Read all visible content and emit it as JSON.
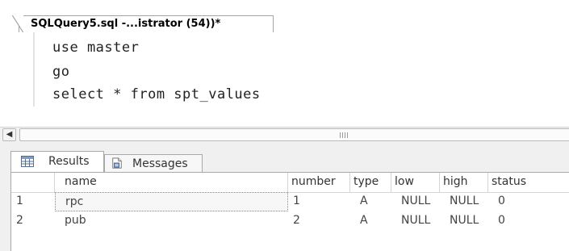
{
  "query_tab": {
    "title": "SQLQuery5.sql -...istrator (54))*"
  },
  "editor": {
    "lines": [
      "use master",
      "go",
      "select * from spt_values"
    ]
  },
  "results": {
    "tabs": {
      "results_label": "Results",
      "messages_label": "Messages"
    },
    "columns": [
      "name",
      "number",
      "type",
      "low",
      "high",
      "status"
    ],
    "rows": [
      {
        "num": "1",
        "cells": [
          "rpc",
          "1",
          "A",
          "NULL",
          "NULL",
          "0"
        ]
      },
      {
        "num": "2",
        "cells": [
          "pub",
          "2",
          "A",
          "NULL",
          "NULL",
          "0"
        ]
      }
    ]
  },
  "icons": {
    "grid": "grid-icon",
    "messages": "messages-icon",
    "scroll_left": "scroll-left-arrow-icon",
    "scroll_grip": "scroll-grip-icon"
  },
  "colors": {
    "panel_bg": "#f0f0f0",
    "border": "#a9a9a9"
  }
}
